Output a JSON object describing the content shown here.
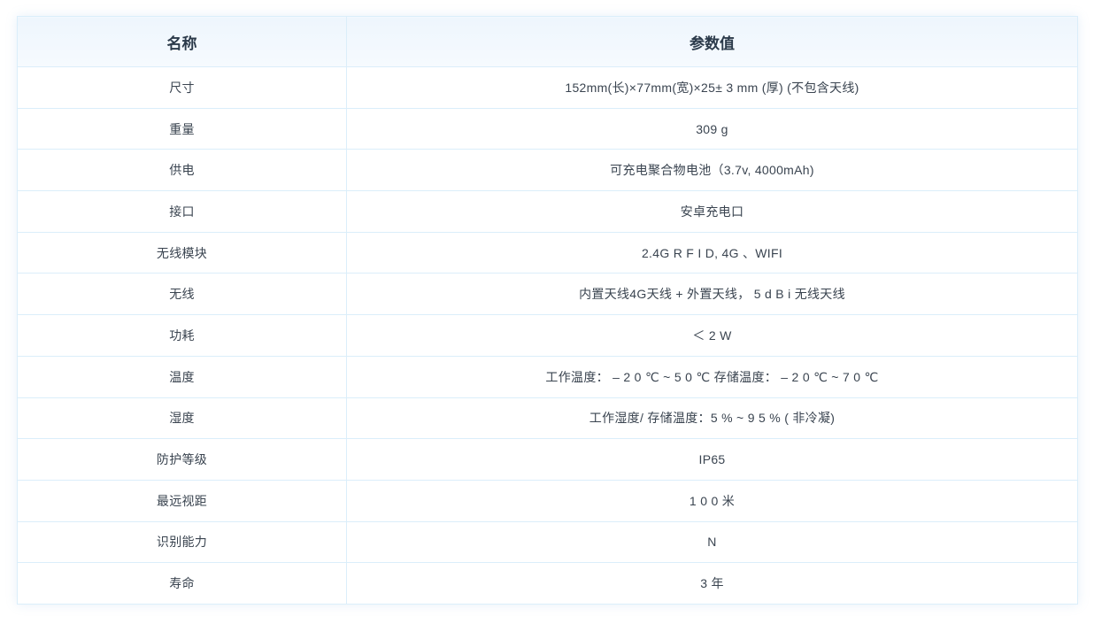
{
  "table": {
    "headers": {
      "name": "名称",
      "value": "参数值"
    },
    "rows": [
      {
        "name": "尺寸",
        "value": "152mm(长)×77mm(宽)×25± 3 mm (厚) (不包含天线)"
      },
      {
        "name": "重量",
        "value": "309 g"
      },
      {
        "name": "供电",
        "value": "可充电聚合物电池（3.7v, 4000mAh)"
      },
      {
        "name": "接口",
        "value": "安卓充电口"
      },
      {
        "name": "无线模块",
        "value": "2.4G  R F I D, 4G 、WIFI"
      },
      {
        "name": "无线",
        "value": "内置天线4G天线 + 外置天线， 5 d B i 无线天线"
      },
      {
        "name": "功耗",
        "value": "＜ 2 W"
      },
      {
        "name": "温度",
        "value": "工作温度： – 2 0 ℃ ~ 5 0 ℃      存储温度： – 2 0 ℃ ~ 7 0 ℃"
      },
      {
        "name": "湿度",
        "value": "工作湿度/ 存储温度：5 % ~ 9 5 % ( 非冷凝)"
      },
      {
        "name": "防护等级",
        "value": "IP65"
      },
      {
        "name": "最远视距",
        "value": "1 0 0 米"
      },
      {
        "name": "识别能力",
        "value": "N"
      },
      {
        "name": "寿命",
        "value": "3 年"
      }
    ]
  }
}
